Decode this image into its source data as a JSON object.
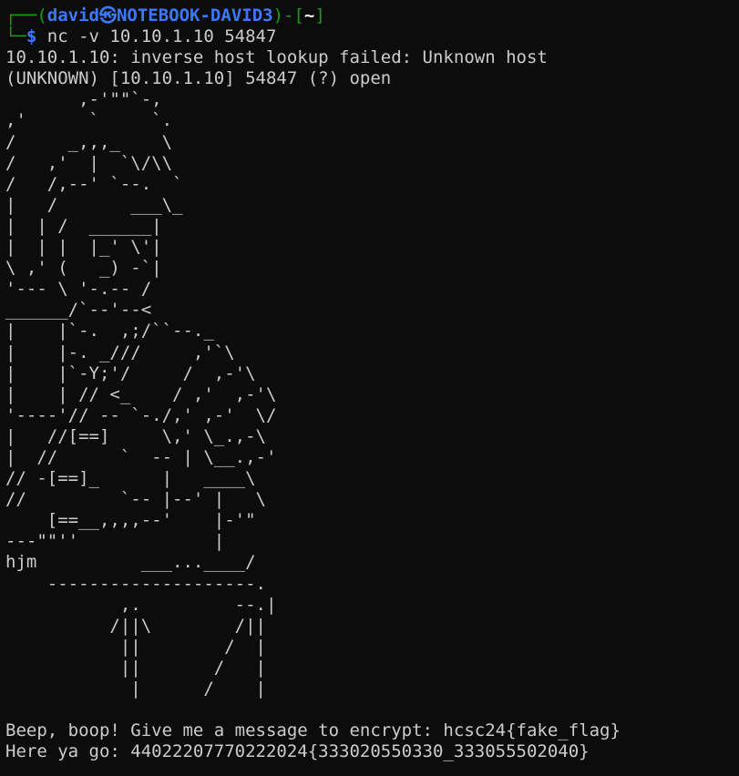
{
  "prompt": {
    "corner_top": "┌──(",
    "user": "david",
    "at_symbol": "㉿",
    "host": "NOTEBOOK-DAVID3",
    "dir_open": ")-[",
    "dir": "~",
    "dir_close": "]",
    "corner_bottom": "└─",
    "dollar": "$",
    "command": " nc -v 10.10.1.10 54847"
  },
  "output": {
    "lookup_line": "10.10.1.10: inverse host lookup failed: Unknown host",
    "open_line": "(UNKNOWN) [10.10.1.10] 54847 (?) open",
    "ascii_art": "       ,-'\"\"`-,\n,'      `     `.\n/     _,,,_    \\\n/   ,'  |  `\\/\\\\\n/   /,--' `--.  `\n|   /       ___\\_\n|  | /  ______|\n|  | |  |_' \\'|\n\\ ,' (   _) -`|\n'--- \\ '-.-- /\n______/`--'--<\n|    |`-.  ,;/``--._\n|    |-. _///     ,'`\\\n|    |`-Y;'/     /  ,-'\\\n|    | // <_    / ,'  ,-'\\\n'----'// -- `-./,' ,-'  \\/\n|   //[==]     \\,' \\_.,-\\\n|  //      `  -- | \\__.,-'\n// -[==]_      |   ____\\\n//         `-- |--' |   \\\n    [==__,,,,--'    |-'\"\n---\"\"''             |\nhjm          ___...____/\n    --------------------.\n           ,.         --.|\n          /||\\        /||\n           ||        /  |\n           ||       /   |\n            |      /    |",
    "message_line": "Beep, boop! Give me a message to encrypt: hcsc24{fake_flag}",
    "result_line": "Here ya go: 44022207770222024{333020550330_333055502040}"
  }
}
